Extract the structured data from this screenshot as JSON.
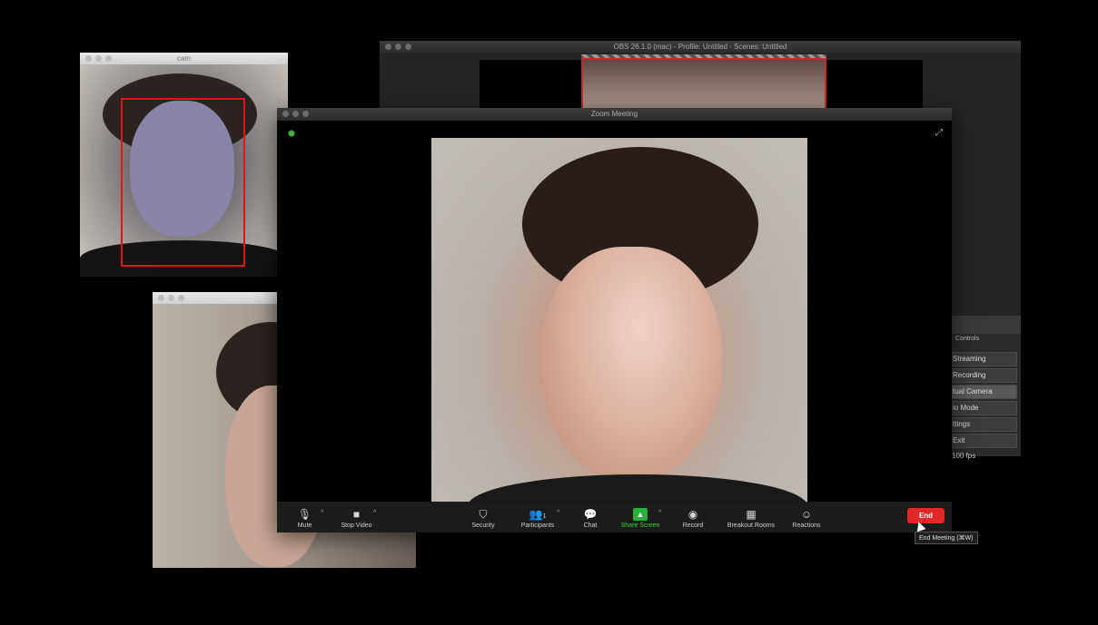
{
  "cam_window": {
    "title": "cam"
  },
  "cam2_window": {
    "title": ""
  },
  "obs_window": {
    "title": "OBS 26.1.0 (mac) - Profile: Untitled - Scenes: Untitled",
    "controls_label": "Controls",
    "buttons": [
      {
        "label": "Streaming",
        "active": false
      },
      {
        "label": "Recording",
        "active": false
      },
      {
        "label": "tual Camera",
        "active": true
      },
      {
        "label": "io Mode",
        "active": false
      },
      {
        "label": "ttings",
        "active": false
      },
      {
        "label": "Exit",
        "active": false
      }
    ],
    "fps": "100 fps"
  },
  "zoom": {
    "title": "Zoom Meeting",
    "toolbar": {
      "mute": "Mute",
      "stop_video": "Stop Video",
      "security": "Security",
      "participants": "Participants",
      "participants_count": "1",
      "chat": "Chat",
      "share_screen": "Share Screen",
      "record": "Record",
      "breakout_rooms": "Breakout Rooms",
      "reactions": "Reactions",
      "end": "End"
    },
    "tooltip": "End Meeting (⌘W)",
    "share_color": "#23b33a",
    "end_color": "#e02828"
  }
}
